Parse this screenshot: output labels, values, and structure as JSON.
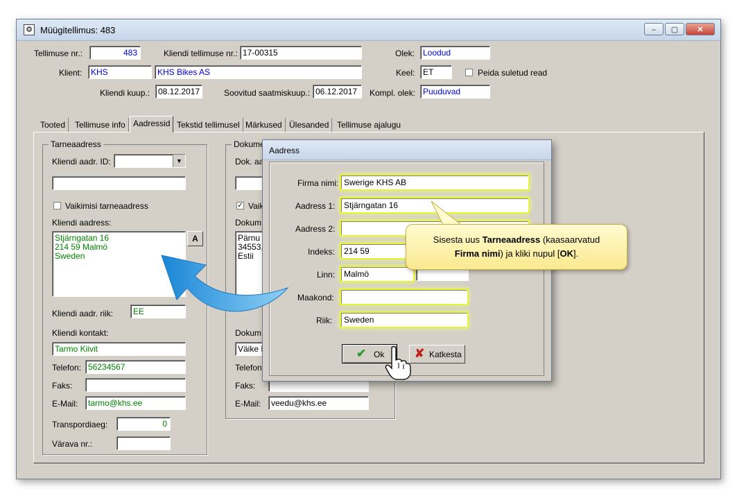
{
  "window": {
    "title": "Müügitellimus: 483",
    "minimize": "–",
    "maximize": "▢",
    "close": "✕"
  },
  "header": {
    "tellimuse_nr_label": "Tellimuse nr.:",
    "tellimuse_nr_value": "483",
    "kliendi_tellimuse_label": "Kliendi tellimuse nr.:",
    "kliendi_tellimuse_value": "17-00315",
    "olek_label": "Olek:",
    "olek_value": "Loodud",
    "klient_label": "Klient:",
    "klient_code": "KHS",
    "klient_name": "KHS Bikes AS",
    "keel_label": "Keel:",
    "keel_value": "ET",
    "peida_label": "Peida suletud read",
    "kuup_label": "Kliendi kuup.:",
    "kuup_value": "08.12.2017",
    "saatmiskuup_label": "Soovitud saatmiskuup.:",
    "saatmiskuup_value": "06.12.2017",
    "kompl_label": "Kompl. olek:",
    "kompl_value": "Puuduvad"
  },
  "tabs": [
    "Tooted",
    "Tellimuse info",
    "Aadressid",
    "Tekstid tellimusel",
    "Märkused",
    "Ülesanded",
    "Tellimuse ajalugu"
  ],
  "tarne": {
    "legend": "Tarneaadress",
    "aadr_id_label": "Kliendi aadr. ID:",
    "vaikimisi_label": "Vaikimisi tarneaadress",
    "aadress_label": "Kliendi aadress:",
    "aadress_value": "Stjärngatan 16\n214 59 Malmö\nSweden",
    "a_button": "A",
    "riik_label": "Kliendi aadr. riik:",
    "riik_value": "EE",
    "kontakt_label": "Kliendi kontakt:",
    "kontakt_value": "Tarmo Kiivit",
    "telefon_label": "Telefon:",
    "telefon_value": "56234567",
    "faks_label": "Faks:",
    "faks_value": "",
    "email_label": "E-Mail:",
    "email_value": "tarmo@khs.ee",
    "transpordiaeg_label": "Transpordiaeg:",
    "transpordiaeg_value": "0",
    "varava_label": "Värava nr.:",
    "varava_value": ""
  },
  "dokument": {
    "legend": "Dokume",
    "dok_label": "Dok. aa",
    "vaik_label": "Vaik",
    "dokum_label": "Dokum.",
    "aadress_value": "Pärnu r\n34553,\nEstii",
    "dokum2_label": "Dokum.",
    "kontakt_value": "Väike F",
    "telefon_label": "Telefon:",
    "faks_label": "Faks:",
    "email_label": "E-Mail:",
    "email_value": "veedu@khs.ee"
  },
  "dialog": {
    "title": "Aadress",
    "firma_label": "Firma nimi:",
    "firma_value": "Swerige KHS AB",
    "aadress1_label": "Aadress 1:",
    "aadress1_value": "Stjärngatan 16",
    "aadress2_label": "Aadress 2:",
    "aadress2_value": "",
    "indeks_label": "Indeks:",
    "indeks_value": "214 59",
    "linn_label": "Linn:",
    "linn_value": "Malmö",
    "maakond_label": "Maakond:",
    "maakond_value": "",
    "riik_label": "Riik:",
    "riik_value": "Sweden",
    "ok_label": "Ok",
    "katkesta_label": "Katkesta"
  },
  "callout": {
    "part1": "Sisesta uus ",
    "bold1": "Tarneaadress",
    "part2": " (kaasaarvatud ",
    "bold2": "Firma nimi",
    "part3": ") ja kliki nupul [",
    "bold3": "OK",
    "part4": "]."
  },
  "colors": {
    "highlight": "#e8f23a",
    "arrow": "#2a9be0",
    "field_blue": "#0000e0",
    "field_green": "#008000"
  }
}
